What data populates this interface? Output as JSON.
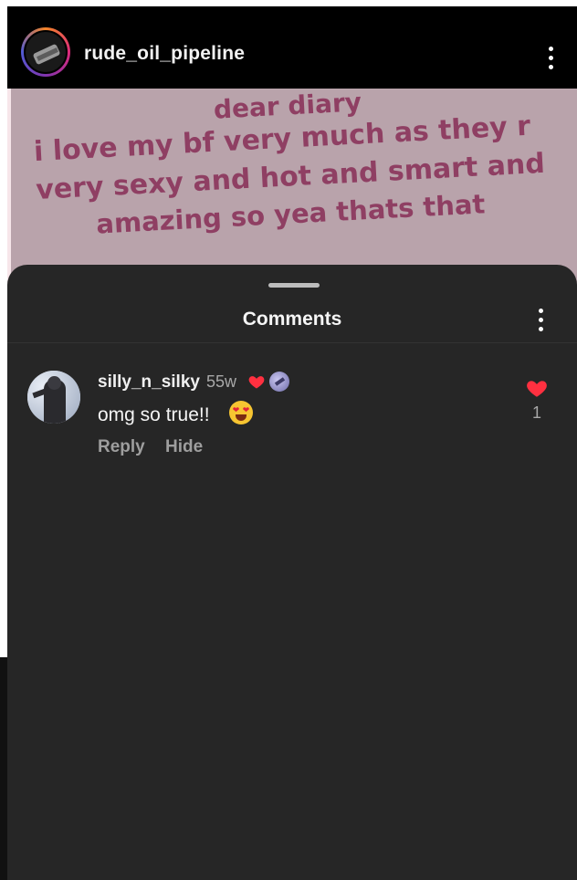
{
  "post": {
    "username": "rude_oil_pipeline",
    "image_text": {
      "line1": "dear diary",
      "line2": "i love my bf very much as they r",
      "line3": "very sexy and hot and smart and",
      "line4": "amazing so yea thats that"
    }
  },
  "comments_sheet": {
    "title": "Comments",
    "comments": [
      {
        "username": "silly_n_silky",
        "time": "55w",
        "text": "omg so true!!",
        "reply_label": "Reply",
        "hide_label": "Hide",
        "like_count": "1"
      }
    ]
  },
  "colors": {
    "header_bg": "#000000",
    "sheet_bg": "#262626",
    "heart": "#ff3040",
    "image_bg": "#b9a3ab",
    "image_text": "#8f3f63"
  },
  "icons": {
    "header_menu": "more-vertical-icon",
    "sheet_menu": "more-vertical-icon",
    "comment_like": "heart-filled-icon",
    "inline_heart": "heart-filled-icon",
    "badge": "profile-badge-icon",
    "emoji": "heart-eyes-emoji"
  }
}
